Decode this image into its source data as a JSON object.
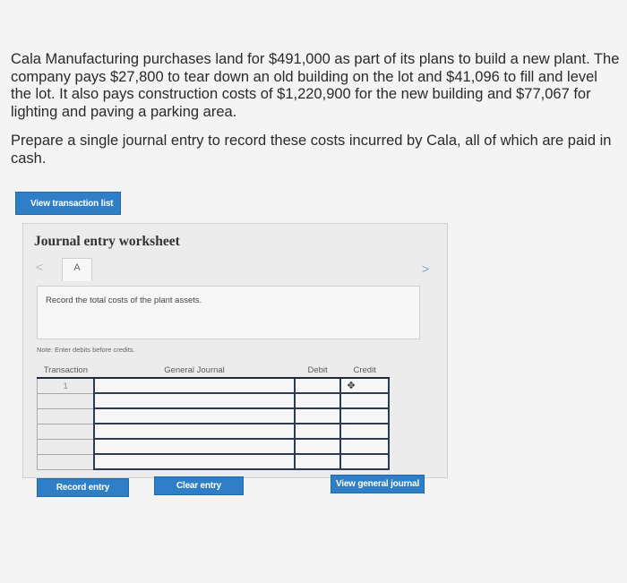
{
  "problem": {
    "paragraph1": "Cala Manufacturing purchases land for $491,000 as part of its plans to build a new plant. The company pays $27,800 to tear down an old building on the lot and $41,096 to fill and level the lot. It also pays construction costs of $1,220,900 for the new building and $77,067 for lighting and paving a parking area.",
    "paragraph2": "Prepare a single journal entry to record these costs incurred by Cala, all of which are paid in cash."
  },
  "buttons": {
    "view_transaction_list": "View transaction list",
    "record_entry": "Record entry",
    "clear_entry": "Clear entry",
    "view_general_journal": "View general journal"
  },
  "worksheet": {
    "title": "Journal entry worksheet",
    "prev_arrow": "<",
    "next_arrow": ">",
    "tab_label": "A",
    "instruction": "Record the total costs of the plant assets.",
    "note": "Note: Enter debits before credits."
  },
  "journal_table": {
    "headers": [
      "Transaction",
      "General Journal",
      "Debit",
      "Credit"
    ],
    "rows": [
      {
        "transaction": "1",
        "account": "",
        "debit": "",
        "credit": ""
      },
      {
        "transaction": "",
        "account": "",
        "debit": "",
        "credit": ""
      },
      {
        "transaction": "",
        "account": "",
        "debit": "",
        "credit": ""
      },
      {
        "transaction": "",
        "account": "",
        "debit": "",
        "credit": ""
      },
      {
        "transaction": "",
        "account": "",
        "debit": "",
        "credit": ""
      },
      {
        "transaction": "",
        "account": "",
        "debit": "",
        "credit": ""
      }
    ]
  },
  "colors": {
    "button_blue": "#2f7fc8",
    "input_border": "#2b3a55",
    "background": "#f4f4f4"
  },
  "icons": {
    "cursor": "move-cursor-icon"
  }
}
